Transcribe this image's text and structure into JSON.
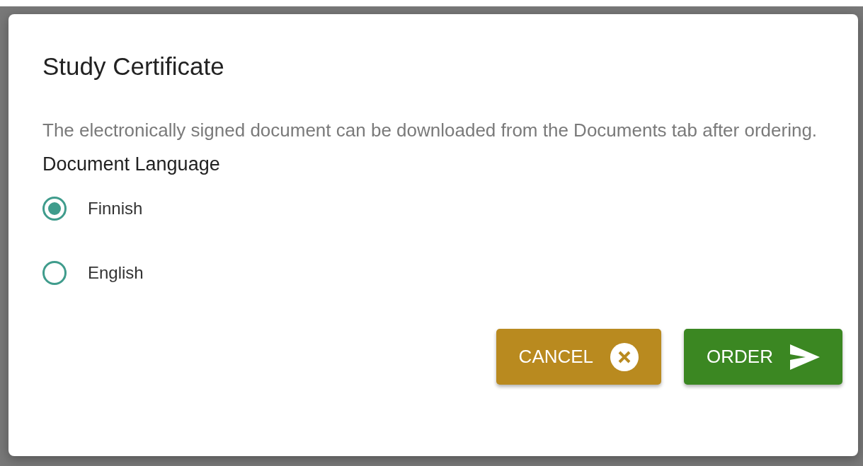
{
  "dialog": {
    "title": "Study Certificate",
    "description": "The electronically signed document can be downloaded from the Documents tab after ordering.",
    "language_label": "Document Language",
    "options": [
      {
        "label": "Finnish",
        "selected": true
      },
      {
        "label": "English",
        "selected": false
      }
    ],
    "buttons": [
      {
        "kind": "cancel",
        "label": "CANCEL"
      },
      {
        "kind": "order",
        "label": "ORDER"
      }
    ]
  }
}
